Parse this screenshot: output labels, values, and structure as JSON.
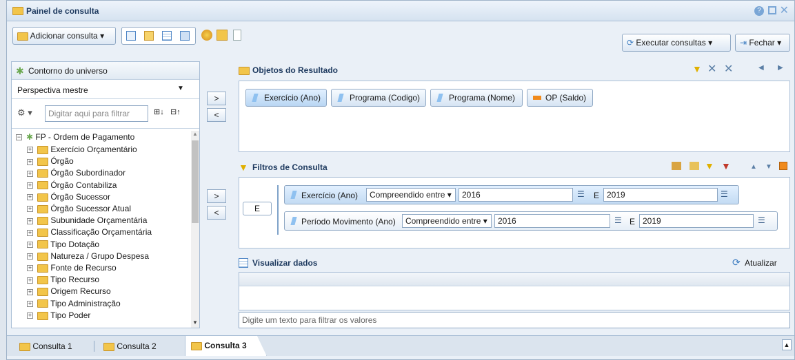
{
  "window": {
    "title": "Painel de consulta"
  },
  "toolbar": {
    "add_query": "Adicionar consulta",
    "run_queries": "Executar consultas",
    "close": "Fechar"
  },
  "universe": {
    "title": "Contorno do universo",
    "perspective": "Perspectiva mestre",
    "filter_placeholder": "Digitar aqui para filtrar",
    "root": "FP - Ordem de Pagamento",
    "items": [
      "Exercício Orçamentário",
      "Órgão",
      "Órgão Subordinador",
      "Órgão Contabiliza",
      "Órgão Sucessor",
      "Órgão Sucessor Atual",
      "Subunidade Orçamentária",
      "Classificação Orçamentária",
      "Tipo Dotação",
      "Natureza / Grupo Despesa",
      "Fonte de Recurso",
      "Tipo Recurso",
      "Origem Recurso",
      "Tipo Administração",
      "Tipo Poder"
    ]
  },
  "result_objects": {
    "title": "Objetos do Resultado",
    "items": [
      "Exercício (Ano)",
      "Programa (Codigo)",
      "Programa (Nome)",
      "OP (Saldo)"
    ]
  },
  "filters": {
    "title": "Filtros de Consulta",
    "operator": "E",
    "rows": [
      {
        "object": "Exercício (Ano)",
        "op": "Compreendido entre",
        "from": "2016",
        "joiner": "E",
        "to": "2019"
      },
      {
        "object": "Período Movimento (Ano)",
        "op": "Compreendido entre",
        "from": "2016",
        "joiner": "E",
        "to": "2019"
      }
    ]
  },
  "data_view": {
    "title": "Visualizar dados",
    "refresh": "Atualizar",
    "filter_placeholder": "Digite um texto para filtrar os valores"
  },
  "tabs": [
    "Consulta 1",
    "Consulta 2",
    "Consulta 3"
  ],
  "arrows": {
    "right": ">",
    "left": "<"
  }
}
